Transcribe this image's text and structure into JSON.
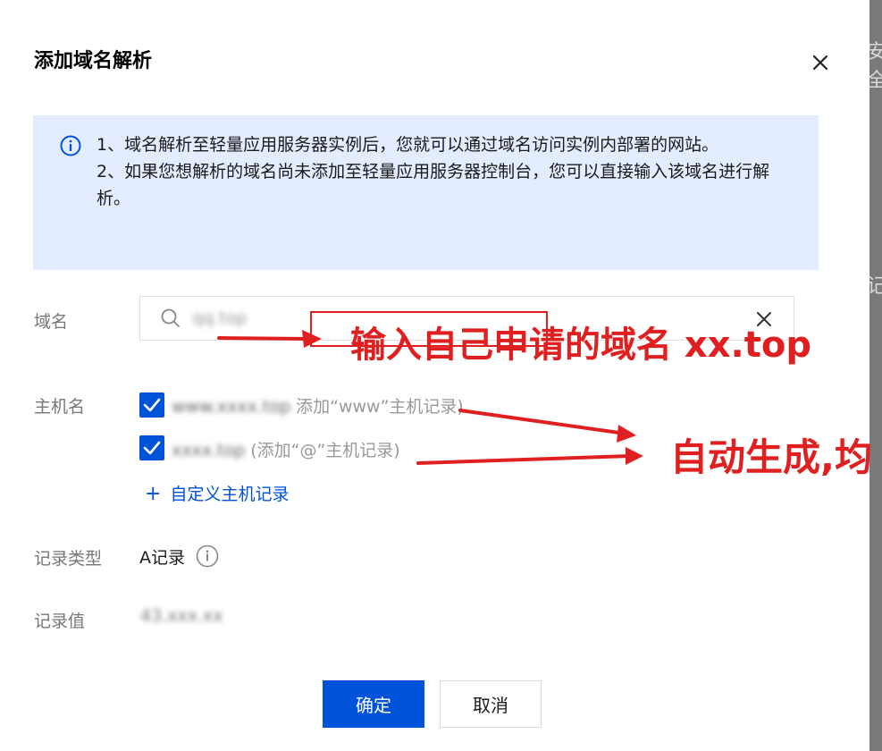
{
  "dialog": {
    "title": "添加域名解析",
    "close_icon": "close-icon"
  },
  "notice": {
    "icon": "info-circle-icon",
    "line1": "1、域名解析至轻量应用服务器实例后，您就可以通过域名访问实例内部署的网站。",
    "line2": "2、如果您想解析的域名尚未添加至轻量应用服务器控制台，您可以直接输入该域名进行解析。"
  },
  "form": {
    "domain": {
      "label": "域名",
      "value": "qq.top",
      "icon": "search-icon",
      "clear_icon": "clear-icon"
    },
    "host": {
      "label": "主机名",
      "options": [
        {
          "checked": true,
          "value": "www.xxxx.top",
          "hint": "添加“www”主机记录)"
        },
        {
          "checked": true,
          "value": "xxxx.top",
          "hint": "(添加“@”主机记录)"
        }
      ],
      "add_custom": "自定义主机记录"
    },
    "record_type": {
      "label": "记录类型",
      "value": "A记录",
      "icon": "info-icon"
    },
    "record_value": {
      "label": "记录值",
      "value": "43.xxx.xx"
    }
  },
  "buttons": {
    "confirm": "确定",
    "cancel": "取消"
  },
  "annotations": {
    "domain_hint": "输入自己申请的域名 xx.top",
    "auto_hint": "自动生成,均",
    "color": "#e02020"
  },
  "background_peek": {
    "top": "安全",
    "middle": "记"
  },
  "colors": {
    "primary": "#0052d9",
    "notice_bg": "#e4ecff"
  }
}
